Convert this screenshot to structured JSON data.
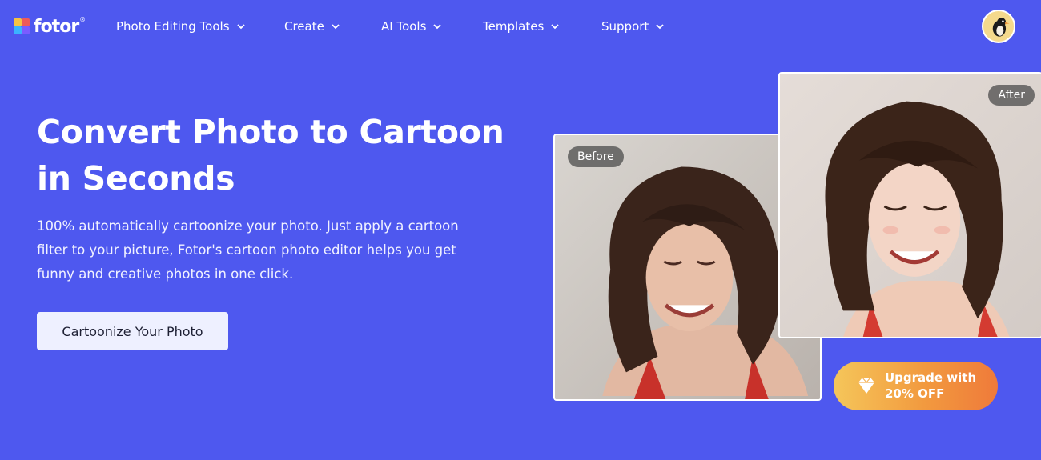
{
  "nav": {
    "logo_text": "fotor",
    "logo_reg": "®",
    "items": [
      {
        "label": "Photo Editing Tools"
      },
      {
        "label": "Create"
      },
      {
        "label": "AI Tools"
      },
      {
        "label": "Templates"
      },
      {
        "label": "Support"
      }
    ]
  },
  "hero": {
    "title": "Convert Photo to Cartoon in Seconds",
    "description": "100% automatically cartoonize your photo. Just apply a cartoon filter to your picture, Fotor's cartoon photo editor helps you get funny and creative photos in one click.",
    "cta_label": "Cartoonize Your Photo"
  },
  "images": {
    "before_label": "Before",
    "after_label": "After"
  },
  "upgrade": {
    "line1": "Upgrade with",
    "line2": "20% OFF"
  },
  "colors": {
    "background": "#4e58ef",
    "cta_bg": "#eef0ff",
    "upgrade_gradient_start": "#f5c65a",
    "upgrade_gradient_end": "#ef7a3a"
  }
}
